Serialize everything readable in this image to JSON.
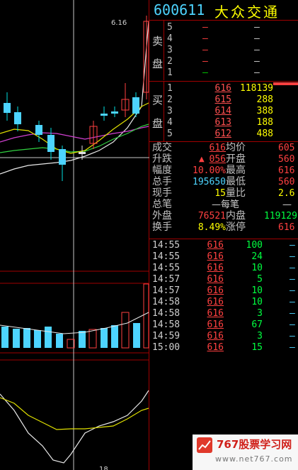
{
  "header": {
    "code": "600611",
    "name": "大众交通"
  },
  "chart": {
    "price_label": "6.16",
    "bottom_label": "18"
  },
  "sell_side": {
    "caption_top": "卖",
    "caption_bottom": "盘",
    "levels": [
      {
        "level": "5",
        "price": "—",
        "volume": "—"
      },
      {
        "level": "4",
        "price": "—",
        "volume": "—"
      },
      {
        "level": "3",
        "price": "—",
        "volume": "—"
      },
      {
        "level": "2",
        "price": "—",
        "volume": "—"
      },
      {
        "level": "1",
        "price": "—",
        "volume": "—"
      }
    ]
  },
  "buy_side": {
    "caption_top": "买",
    "caption_bottom": "盘",
    "levels": [
      {
        "level": "1",
        "price": "616",
        "volume": "118139"
      },
      {
        "level": "2",
        "price": "615",
        "volume": "288"
      },
      {
        "level": "3",
        "price": "614",
        "volume": "388"
      },
      {
        "level": "4",
        "price": "613",
        "volume": "188"
      },
      {
        "level": "5",
        "price": "612",
        "volume": "488"
      }
    ]
  },
  "stats": {
    "r1": {
      "l1": "成交",
      "v1": "616",
      "l2": "均价",
      "v2": "605"
    },
    "r2": {
      "l1": "升跌",
      "arrow": "▲",
      "v1": "056",
      "l2": "开盘",
      "v2": "560"
    },
    "r3": {
      "l1": "幅度",
      "v1": "10.00%",
      "l2": "最高",
      "v2": "616"
    },
    "r4": {
      "l1": "总手",
      "v1": "195650",
      "l2": "最低",
      "v2": "560"
    },
    "r5": {
      "l1": "现手",
      "v1": "15",
      "l2": "量比",
      "v2": "2.6"
    },
    "r6": {
      "l1": "总笔",
      "v1": "—每笔",
      "v2": "—"
    },
    "r7": {
      "l1": "外盘",
      "v1": "76521",
      "l2": "内盘",
      "v2": "119129"
    },
    "r8": {
      "l1": "换手",
      "v1": "8.49%",
      "l2": "涨停",
      "v2": "616"
    }
  },
  "ticks": [
    {
      "time": "14:55",
      "price": "616",
      "vol": "100",
      "dash": "—"
    },
    {
      "time": "14:55",
      "price": "616",
      "vol": "24",
      "dash": "—"
    },
    {
      "time": "14:55",
      "price": "616",
      "vol": "10",
      "dash": "—"
    },
    {
      "time": "14:57",
      "price": "616",
      "vol": "5",
      "dash": "—"
    },
    {
      "time": "14:57",
      "price": "616",
      "vol": "10",
      "dash": "—"
    },
    {
      "time": "14:58",
      "price": "616",
      "vol": "10",
      "dash": "—"
    },
    {
      "time": "14:58",
      "price": "616",
      "vol": "3",
      "dash": "—"
    },
    {
      "time": "14:58",
      "price": "616",
      "vol": "67",
      "dash": "—"
    },
    {
      "time": "14:59",
      "price": "616",
      "vol": "3",
      "dash": "—"
    },
    {
      "time": "15:00",
      "price": "616",
      "vol": "15",
      "dash": "—"
    }
  ],
  "watermark": {
    "title": "767股票学习网",
    "url": "www.net767.com"
  }
}
